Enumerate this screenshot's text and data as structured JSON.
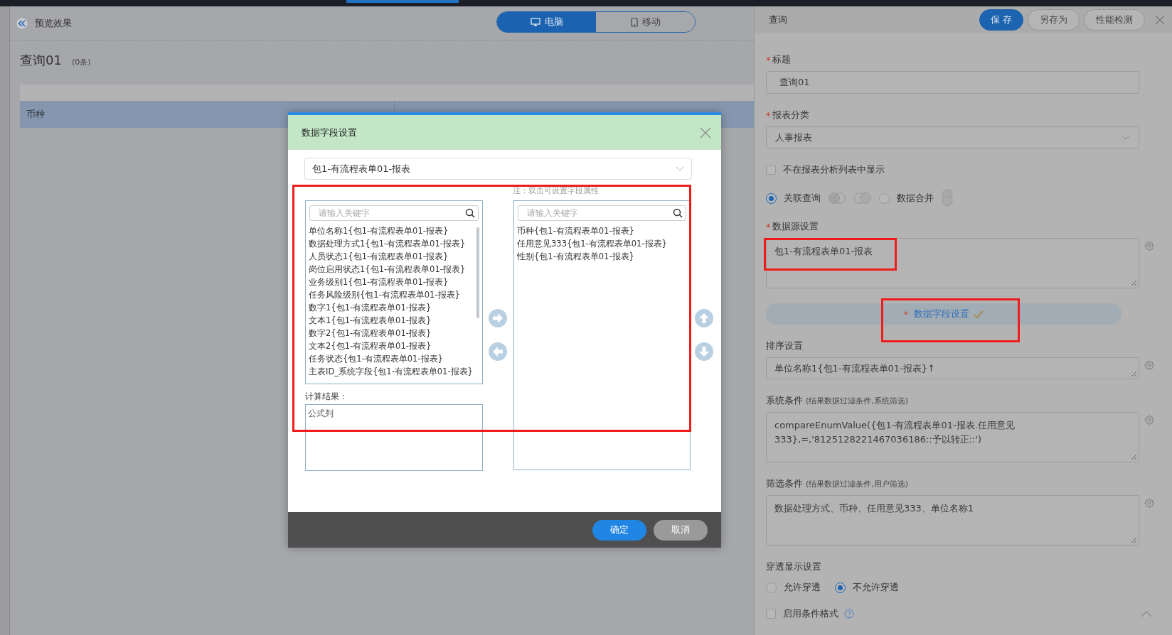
{
  "preview": {
    "title": "预览效果",
    "view_toggle": [
      {
        "label": "电脑",
        "kind": "desktop",
        "selected": true
      },
      {
        "label": "移动",
        "kind": "mobile",
        "selected": false
      }
    ],
    "query_title": "查询01",
    "count": "(0条)",
    "table": {
      "rows": [
        {
          "cells": [
            "币种"
          ]
        }
      ]
    }
  },
  "dialog": {
    "title": "数据字段设置",
    "source": "包1-有流程表单01-报表",
    "note": "注：双击可设置字段属性",
    "available": {
      "placeholder": "请输入关键字",
      "items": [
        "单位名称1{包1-有流程表单01-报表}",
        "数据处理方式1{包1-有流程表单01-报表}",
        "人员状态1{包1-有流程表单01-报表}",
        "岗位启用状态1{包1-有流程表单01-报表}",
        "业务级别1{包1-有流程表单01-报表}",
        "任务风险级别{包1-有流程表单01-报表}",
        "数字1{包1-有流程表单01-报表}",
        "文本1{包1-有流程表单01-报表}",
        "数字2{包1-有流程表单01-报表}",
        "文本2{包1-有流程表单01-报表}",
        "任务状态{包1-有流程表单01-报表}",
        "主表ID_系统字段{包1-有流程表单01-报表}"
      ]
    },
    "chosen": {
      "placeholder": "请输入关键字",
      "items": [
        "币种{包1-有流程表单01-报表}",
        "任用意见333{包1-有流程表单01-报表}",
        "性别{包1-有流程表单01-报表}"
      ]
    },
    "calc_label": "计算结果：",
    "calc_value": "公式列",
    "buttons": [
      {
        "label": "确定",
        "kind": "primary"
      },
      {
        "label": "取消",
        "kind": "secondary"
      }
    ]
  },
  "panel": {
    "title": "查询",
    "buttons": [
      {
        "label": "保 存",
        "kind": "primary"
      },
      {
        "label": "另存为",
        "kind": "secondary"
      },
      {
        "label": "性能检测",
        "kind": "secondary"
      }
    ],
    "fields": [
      {
        "kind": "input",
        "mark": "*",
        "label": "标题",
        "value": "查询01"
      },
      {
        "kind": "select",
        "mark": "*",
        "label": "报表分类",
        "value": "人事报表"
      },
      {
        "kind": "checkbox",
        "label": "不在报表分析列表中显示",
        "checked": false
      },
      {
        "kind": "mode",
        "options": [
          {
            "label": "关联查询",
            "selected": true
          },
          {
            "label": "数据合并",
            "selected": false
          }
        ]
      },
      {
        "kind": "textarea",
        "mark": "*",
        "label": "数据源设置",
        "value": "包1-有流程表单01-报表"
      },
      {
        "kind": "action",
        "mark": "*",
        "label": "数据字段设置",
        "done": true
      },
      {
        "kind": "line",
        "label": "排序设置",
        "value": "单位名称1{包1-有流程表单01-报表}↑"
      },
      {
        "kind": "textarea",
        "label": "系统条件",
        "hint": "(结果数据过滤条件,系统筛选)",
        "value": "compareEnumValue({包1-有流程表单01-报表.任用意见333},=,'8125128221467036186::予以转正::')"
      },
      {
        "kind": "textarea",
        "label": "筛选条件",
        "hint": "(结果数据过滤条件,用户筛选)",
        "value": "数据处理方式、币种、任用意见333、单位名称1"
      },
      {
        "kind": "radio",
        "label": "穿透显示设置",
        "options": [
          {
            "label": "允许穿透",
            "selected": false
          },
          {
            "label": "不允许穿透",
            "selected": true
          }
        ]
      },
      {
        "kind": "checkbox",
        "label": "启用条件格式",
        "checked": false,
        "help": true
      }
    ]
  }
}
